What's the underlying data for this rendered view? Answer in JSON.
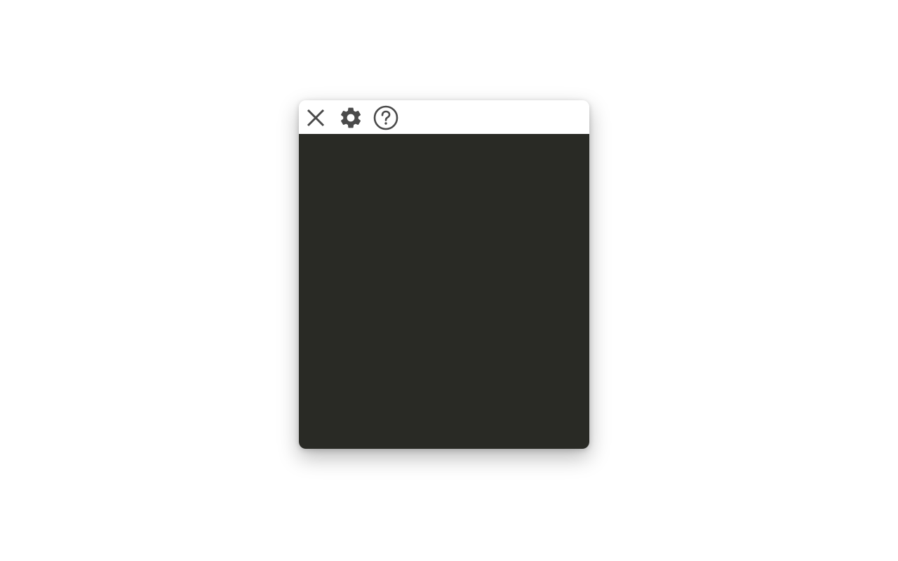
{
  "toolbar": {
    "buttons": [
      {
        "icon": "close-icon",
        "label": ""
      },
      {
        "icon": "gear-icon",
        "label": ""
      },
      {
        "icon": "help-circle-icon",
        "label": ""
      }
    ]
  },
  "colors": {
    "icon": "#4a4a4a",
    "toolbar_bg": "#ffffff",
    "panel_bg": "#292a25",
    "page_bg": "#ffffff"
  }
}
